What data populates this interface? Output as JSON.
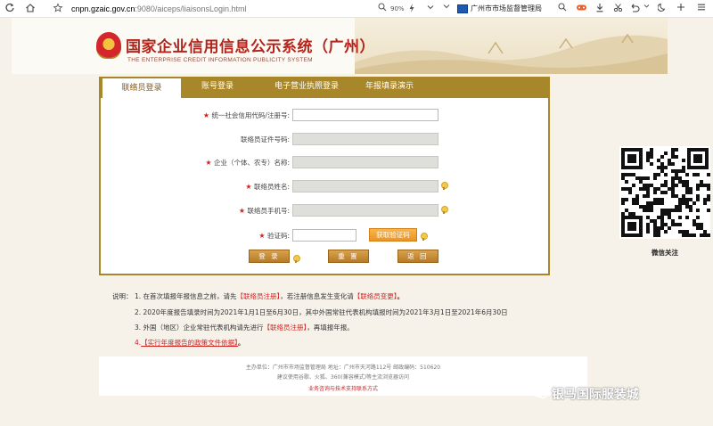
{
  "browser": {
    "url_host": "cnpn.gzaic.gov.cn",
    "url_rest": ":9080/aiceps/liaisonsLogin.html",
    "zoom": "90%",
    "site_name": "广州市市场监督管理局"
  },
  "header": {
    "title_cn": "国家企业信用信息公示系统（广州）",
    "title_en": "THE ENTERPRISE CREDIT INFORMATION PUBLICITY SYSTEM"
  },
  "tabs": [
    {
      "label": "联络员登录",
      "active": true
    },
    {
      "label": "账号登录",
      "active": false
    },
    {
      "label": "电子营业执照登录",
      "active": false
    },
    {
      "label": "年报填录演示",
      "active": false
    }
  ],
  "form": {
    "fields": [
      {
        "label": "统一社会信用代码/注册号:",
        "value": ""
      },
      {
        "label": "联络员证件号码:",
        "value": ""
      },
      {
        "label": "企业（个体、农专）名称:",
        "value": ""
      },
      {
        "label": "联络员姓名:",
        "value": ""
      },
      {
        "label": "联络员手机号:",
        "value": ""
      },
      {
        "label": "验证码:",
        "value": ""
      }
    ],
    "sms_button": "获取验证码",
    "login_button": "登 录",
    "reset_button": "重 置",
    "back_button": "返 回"
  },
  "notes": {
    "heading": "说明：",
    "n1_a": "1. 在首次填报年报信息之前，请先",
    "n1_link1": "【联络员注册】",
    "n1_b": "，若注册信息发生变化请",
    "n1_link2": "【联络员变更】",
    "n1_c": "。",
    "n2": "2. 2020年度报告填录时间为2021年1月1日至6月30日，其中外国常驻代表机构填报时间为2021年3月1日至2021年6月30日",
    "n3_a": "3. 外国（地区）企业常驻代表机构请先进行",
    "n3_link": "【联络员注册】",
    "n3_b": "，再填报年报。",
    "n4_a": "4.",
    "n4_link": "【实行年度报告的政策文件依据】",
    "n4_b": "。"
  },
  "footer": {
    "line1": "主办单位：广州市市场监督管理局   地址：广州市天河路112号   邮政编码：510620",
    "line2": "建议使用谷歌、火狐、360(兼容模式)等主流浏览器访问",
    "line3": "业务咨询与技术支持联系方式"
  },
  "qr": {
    "caption": "微信关注"
  },
  "watermark": "银马国际服装城"
}
